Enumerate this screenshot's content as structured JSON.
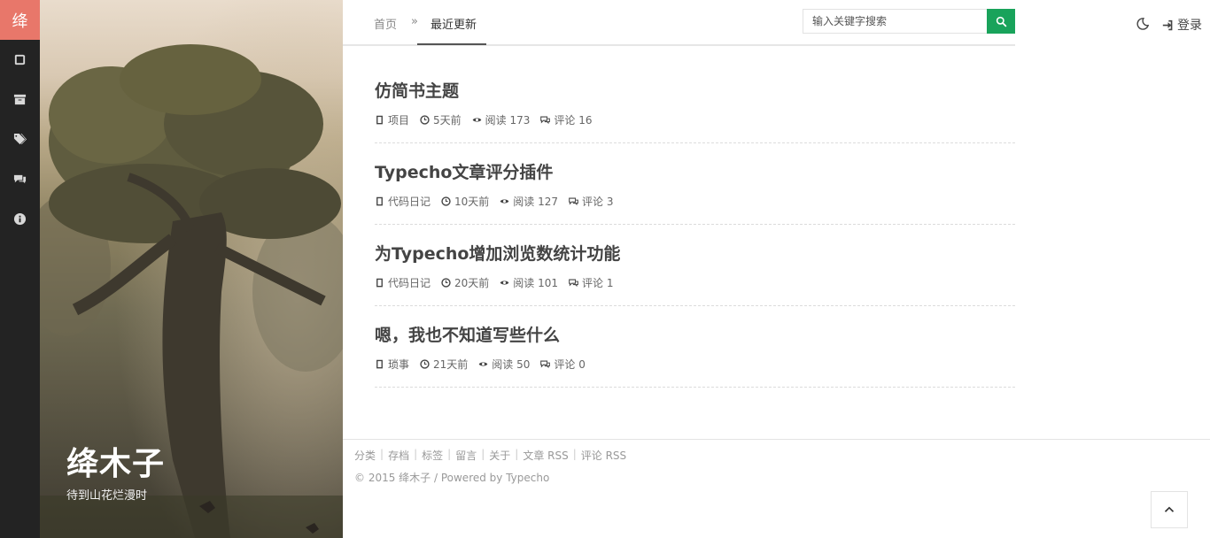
{
  "sidebar": {
    "logo": "绛",
    "items": [
      {
        "icon": "book-icon"
      },
      {
        "icon": "archive-icon"
      },
      {
        "icon": "tags-icon"
      },
      {
        "icon": "comments-icon"
      },
      {
        "icon": "info-icon"
      }
    ]
  },
  "hero": {
    "title": "绛木子",
    "subtitle": "待到山花烂漫时"
  },
  "breadcrumb": {
    "home": "首页",
    "separator": "»",
    "current": "最近更新"
  },
  "search": {
    "placeholder": "输入关键字搜索"
  },
  "header": {
    "login": "登录"
  },
  "posts": [
    {
      "title": "仿简书主题",
      "category": "项目",
      "time": "5天前",
      "views": "阅读 173",
      "comments": "评论 16"
    },
    {
      "title": "Typecho文章评分插件",
      "category": "代码日记",
      "time": "10天前",
      "views": "阅读 127",
      "comments": "评论 3"
    },
    {
      "title": "为Typecho增加浏览数统计功能",
      "category": "代码日记",
      "time": "20天前",
      "views": "阅读 101",
      "comments": "评论 1"
    },
    {
      "title": "嗯，我也不知道写些什么",
      "category": "琐事",
      "time": "21天前",
      "views": "阅读 50",
      "comments": "评论 0"
    }
  ],
  "footer": {
    "links": [
      "分类",
      "存档",
      "标签",
      "留言",
      "关于",
      "文章 RSS",
      "评论 RSS"
    ],
    "copyright": "© 2015 绛木子 / Powered by Typecho"
  },
  "colors": {
    "accent": "#e8776a",
    "search_button": "#19a35b",
    "sidebar": "#232323"
  }
}
